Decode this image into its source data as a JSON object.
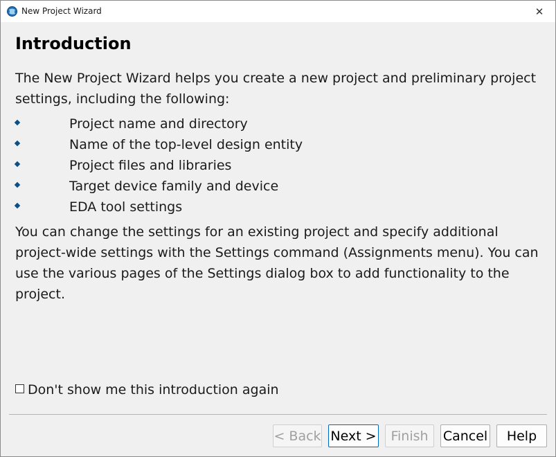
{
  "window": {
    "title": "New Project Wizard",
    "app_icon": "globe-icon",
    "close_icon": "close-icon",
    "close_glyph": "✕"
  },
  "page": {
    "heading": "Introduction",
    "intro": "The New Project Wizard helps you create a new project and preliminary project settings, including the following:",
    "bullets": [
      "Project name and directory",
      "Name of the top-level design entity",
      "Project files and libraries",
      "Target device family and device",
      "EDA tool settings"
    ],
    "settings_note": "You can change the settings for an existing project and specify additional project-wide settings with the Settings command (Assignments menu). You can use the various pages of the Settings dialog box to add functionality to the project."
  },
  "checkbox": {
    "label": "Don't show me this introduction again",
    "checked": false
  },
  "buttons": {
    "back": "< Back",
    "next": "Next >",
    "finish": "Finish",
    "cancel": "Cancel",
    "help": "Help"
  },
  "colors": {
    "bullet": "#0a4f87",
    "default_button_border": "#0067c0"
  }
}
